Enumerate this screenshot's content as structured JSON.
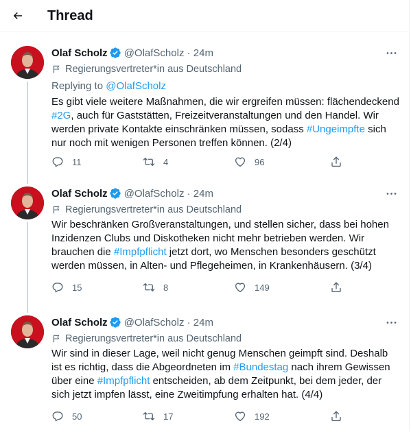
{
  "header": {
    "title": "Thread"
  },
  "tweets": [
    {
      "author": {
        "name": "Olaf Scholz",
        "handle": "@OlafScholz",
        "time": "24m"
      },
      "label": "Regierungsvertreter*in aus Deutschland",
      "replying_prefix": "Replying to ",
      "replying_handle": "@OlafScholz",
      "lines": [
        [
          "Es gibt viele weitere Maßnahmen, die wir ergreifen müssen: flächendeckend"
        ],
        [
          "#2G",
          ", auch für Gaststätten, Freizeitveranstaltungen und den Handel. Wir"
        ],
        [
          "werden private Kontakte einschränken müssen, sodass ",
          "#Ungeimpfte",
          " sich"
        ],
        [
          "nur noch mit wenigen Personen treffen können. (2/4)"
        ]
      ],
      "stats": {
        "replies": "11",
        "retweets": "4",
        "likes": "96"
      }
    },
    {
      "author": {
        "name": "Olaf Scholz",
        "handle": "@OlafScholz",
        "time": "24m"
      },
      "label": "Regierungsvertreter*in aus Deutschland",
      "lines": [
        [
          "Wir beschränken Großveranstaltungen, und stellen sicher, dass bei hohen"
        ],
        [
          "Inzidenzen Clubs und Diskotheken nicht mehr betrieben werden. Wir"
        ],
        [
          "brauchen die ",
          "#Impfpflicht",
          " jetzt dort, wo Menschen besonders geschützt"
        ],
        [
          "werden müssen, in Alten- und Pflegeheimen, in Krankenhäusern. (3/4)"
        ]
      ],
      "stats": {
        "replies": "15",
        "retweets": "8",
        "likes": "149"
      }
    },
    {
      "author": {
        "name": "Olaf Scholz",
        "handle": "@OlafScholz",
        "time": "24m"
      },
      "label": "Regierungsvertreter*in aus Deutschland",
      "lines": [
        [
          "Wir sind in dieser Lage, weil nicht genug Menschen geimpft sind. Deshalb"
        ],
        [
          "ist es richtig, dass die Abgeordneten im ",
          "#Bundestag",
          " nach ihrem Gewissen"
        ],
        [
          "über eine ",
          "#Impfpflicht",
          " entscheiden, ab dem Zeitpunkt, bei dem jeder, der"
        ],
        [
          "sich jetzt impfen lässt, eine Zweitimpfung erhalten hat. (4/4)"
        ]
      ],
      "stats": {
        "replies": "50",
        "retweets": "17",
        "likes": "192"
      }
    }
  ],
  "colors": {
    "accent": "#1d9bf0",
    "text": "#0f1419",
    "muted": "#536471",
    "border": "#eff3f4",
    "thread_line": "#cfd9de",
    "avatar_bg": "#c8101e"
  },
  "icons": {
    "back": "arrow-left-icon",
    "verified": "verified-badge-icon",
    "label": "flag-icon",
    "more": "more-horizontal-icon",
    "reply": "reply-icon",
    "retweet": "retweet-icon",
    "like": "heart-icon",
    "share": "share-icon"
  }
}
